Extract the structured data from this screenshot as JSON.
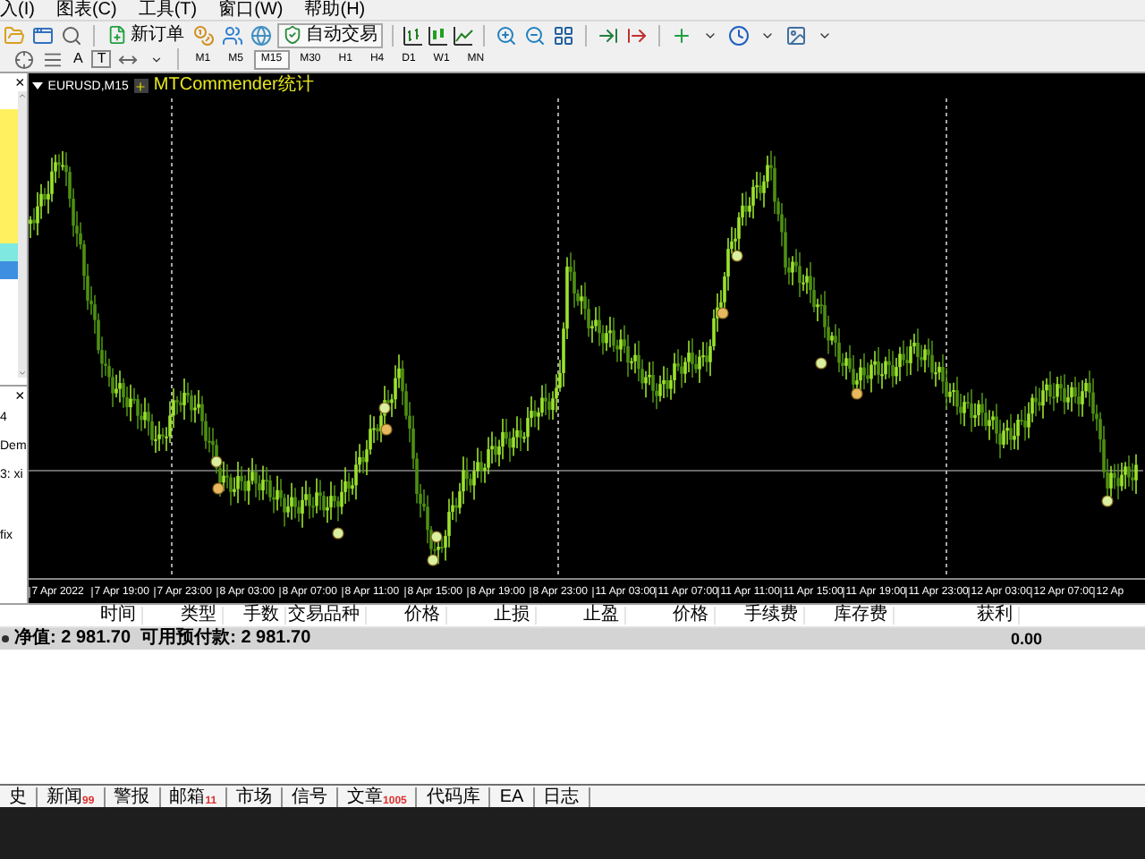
{
  "menu": [
    "入(I)",
    "图表(C)",
    "工具(T)",
    "窗口(W)",
    "帮助(H)"
  ],
  "toolbar": {
    "new_order": "新订单",
    "auto_trading": "自动交易"
  },
  "drawing_tools": {
    "text_tool": "A",
    "label_tool": "T"
  },
  "timeframes": [
    {
      "label": "M1",
      "selected": false
    },
    {
      "label": "M5",
      "selected": false
    },
    {
      "label": "M15",
      "selected": true
    },
    {
      "label": "M30",
      "selected": false
    },
    {
      "label": "H1",
      "selected": false
    },
    {
      "label": "H4",
      "selected": false
    },
    {
      "label": "D1",
      "selected": false
    },
    {
      "label": "W1",
      "selected": false
    },
    {
      "label": "MN",
      "selected": false
    }
  ],
  "market_watch": {
    "close": "×"
  },
  "navigator": {
    "close": "×",
    "fragments": [
      "4",
      "Dem",
      "3: xi",
      "fix"
    ]
  },
  "chart": {
    "symbol": "EURUSD,M15",
    "indicator": "MTCommender统计",
    "time_labels": [
      "7 Apr 2022",
      "7 Apr 19:00",
      "7 Apr 23:00",
      "8 Apr 03:00",
      "8 Apr 07:00",
      "8 Apr 11:00",
      "8 Apr 15:00",
      "8 Apr 19:00",
      "8 Apr 23:00",
      "11 Apr 03:00",
      "11 Apr 07:00",
      "11 Apr 11:00",
      "11 Apr 15:00",
      "11 Apr 19:00",
      "11 Apr 23:00",
      "12 Apr 03:00",
      "12 Apr 07:00",
      "12 Ap"
    ]
  },
  "terminal": {
    "columns": [
      "时间",
      "类型",
      "手数",
      "交易品种",
      "价格",
      "止损",
      "止盈",
      "价格",
      "手续费",
      "库存费",
      "获利"
    ],
    "summary": "净值: 2 981.70  可用预付款: 2 981.70",
    "profit": "0.00"
  },
  "terminal_tabs": [
    {
      "label": "史"
    },
    {
      "label": "新闻",
      "badge": "99"
    },
    {
      "label": "警报"
    },
    {
      "label": "邮箱",
      "badge": "11"
    },
    {
      "label": "市场"
    },
    {
      "label": "信号"
    },
    {
      "label": "文章",
      "badge": "1005"
    },
    {
      "label": "代码库"
    },
    {
      "label": "EA"
    },
    {
      "label": "日志"
    }
  ]
}
